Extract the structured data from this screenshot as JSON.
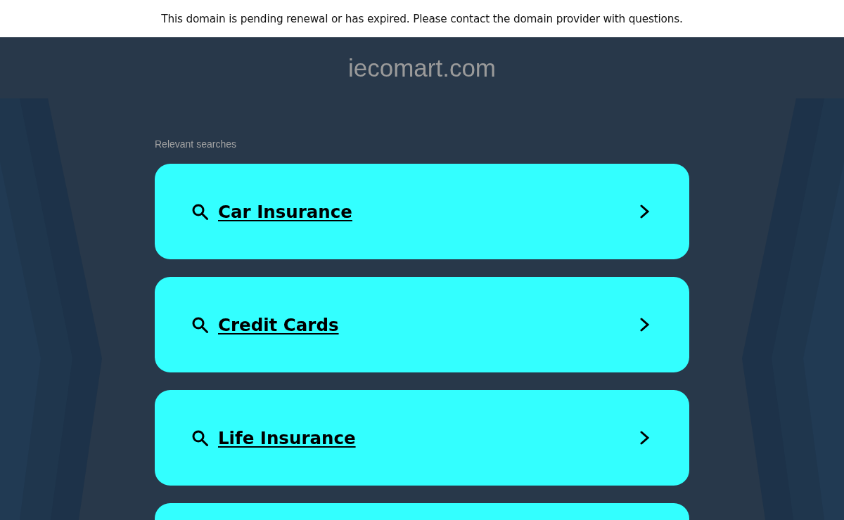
{
  "notice": {
    "text": "This domain is pending renewal or has expired. Please contact the domain provider with questions."
  },
  "header": {
    "title": "iecomart.com"
  },
  "searches": {
    "heading": "Relevant searches",
    "items": [
      {
        "label": "Car Insurance"
      },
      {
        "label": "Credit Cards"
      },
      {
        "label": "Life Insurance"
      }
    ],
    "more_below": true
  }
}
